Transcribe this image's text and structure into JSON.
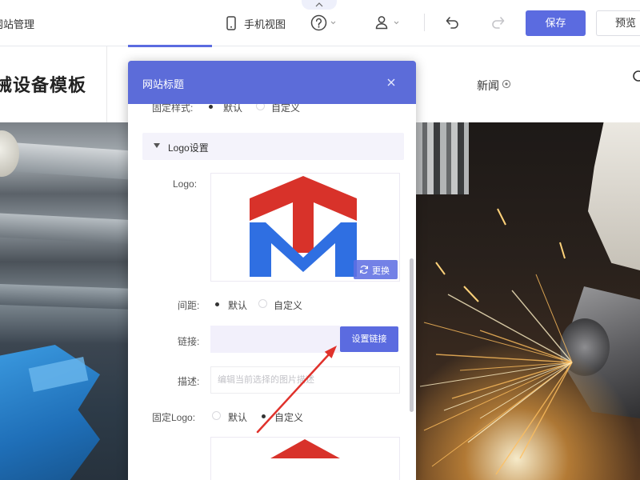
{
  "app": {
    "title": "网站管理"
  },
  "toolbar": {
    "mobile_view_label": "手机视图",
    "save_label": "保存",
    "preview_label": "预览",
    "icons": [
      "phone-icon",
      "help-icon",
      "chevron-down-icon",
      "user-icon",
      "undo-icon",
      "redo-icon",
      "chevron-up-icon"
    ]
  },
  "preview": {
    "site_title": "械设备模板",
    "nav_item": "新闻"
  },
  "panel": {
    "title": "网站标题",
    "fixed_style": {
      "label": "固定样式:",
      "options": [
        "默认",
        "自定义"
      ],
      "selected": "默认"
    },
    "logo_section": {
      "label": "Logo设置",
      "expanded": true
    },
    "logo": {
      "label": "Logo:",
      "replace_label": "更换"
    },
    "spacing": {
      "label": "间距:",
      "options": [
        "默认",
        "自定义"
      ],
      "selected": "默认"
    },
    "link": {
      "label": "链接:",
      "button_label": "设置链接"
    },
    "description": {
      "label": "描述:",
      "placeholder": "编辑当前选择的图片描述"
    },
    "fixed_logo": {
      "label": "固定Logo:",
      "options": [
        "默认",
        "自定义"
      ],
      "selected": "自定义"
    }
  },
  "colors": {
    "accent": "#5b6be0",
    "panel_header": "#5c6cd9",
    "logo_red": "#d8322a",
    "logo_blue": "#2f6fe2",
    "annotation_arrow": "#e0322c"
  }
}
